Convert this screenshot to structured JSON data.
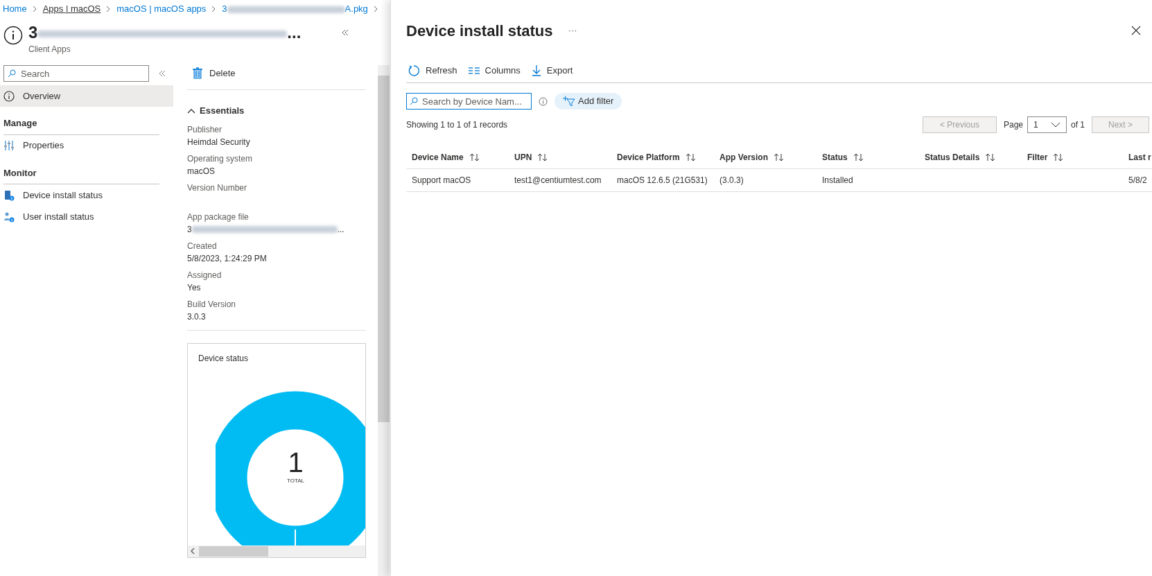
{
  "breadcrumb": [
    {
      "label": "Home",
      "underlined": false
    },
    {
      "label": "Apps | macOS",
      "underlined": true
    },
    {
      "label": "macOS | macOS apps",
      "underlined": false
    },
    {
      "label_start": "3",
      "label_end": "A.pkg",
      "underlined": false
    }
  ],
  "blade": {
    "title_start": "3",
    "title_end": "...",
    "subtitle": "Client Apps"
  },
  "nav": {
    "search_placeholder": "Search",
    "items": [
      {
        "kind": "item",
        "label": "Overview",
        "selected": true
      },
      {
        "kind": "section",
        "label": "Manage"
      },
      {
        "kind": "item",
        "label": "Properties",
        "selected": false
      },
      {
        "kind": "section",
        "label": "Monitor"
      },
      {
        "kind": "item",
        "label": "Device install status",
        "selected": false
      },
      {
        "kind": "item",
        "label": "User install status",
        "selected": false
      }
    ]
  },
  "overview": {
    "toolbar": [
      "Delete"
    ],
    "essentials_title": "Essentials",
    "expanded": true,
    "fields": [
      {
        "label": "Publisher",
        "value": "Heimdal Security"
      },
      {
        "label": "Operating system",
        "value": "macOS"
      },
      {
        "label": "Version Number"
      },
      {
        "label": "App package file",
        "value_start": "3",
        "value_end": "..."
      },
      {
        "label": "Created",
        "value": "5/8/2023, 1:24:29 PM"
      },
      {
        "label": "Assigned",
        "value": "Yes"
      },
      {
        "label": "Build Version",
        "value": "3.0.3"
      }
    ],
    "device_status": {
      "title": "Device status",
      "total": "1",
      "total_label": "TOTAL"
    }
  },
  "panel": {
    "title": "Device install status",
    "more": "···",
    "toolbar": [
      {
        "label": "Refresh"
      },
      {
        "label": "Columns"
      },
      {
        "label": "Export"
      }
    ],
    "search_placeholder": "Search by Device Nam...",
    "add_filter": "Add filter",
    "showing": "Showing 1 to 1 of 1 records",
    "pager": {
      "previous": "< Previous",
      "page_label": "Page",
      "page": "1",
      "of": "of 1",
      "next": "Next >",
      "previous_disabled": true,
      "next_disabled": true
    },
    "columns": [
      "Device Name",
      "UPN",
      "Device Platform",
      "App Version",
      "Status",
      "Status Details",
      "Filter",
      "Last r"
    ],
    "rows": [
      [
        "Support macOS",
        "test1@centiumtest.com",
        "macOS 12.6.5 (21G531)",
        "(3.0.3)",
        "Installed",
        "",
        "",
        "5/8/2"
      ]
    ]
  }
}
